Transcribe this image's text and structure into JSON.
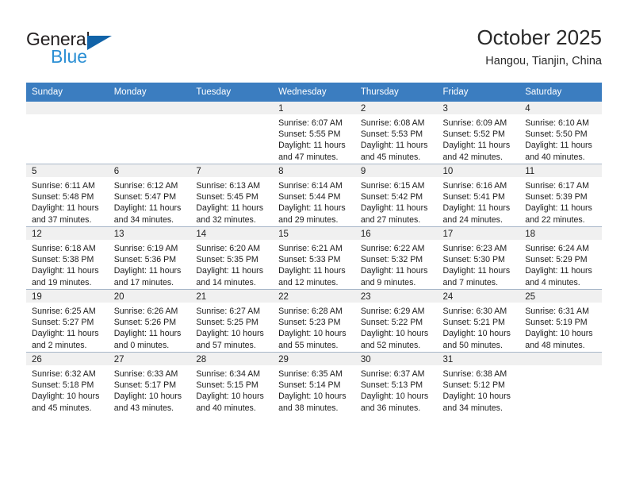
{
  "brand": {
    "name_dark": "General",
    "name_light": "Blue",
    "triangle_color": "#1163a8",
    "blue_color": "#2b8fd4"
  },
  "header": {
    "title": "October 2025",
    "subtitle": "Hangou, Tianjin, China"
  },
  "theme": {
    "header_row_bg": "#3b7dc0",
    "header_row_text": "#ffffff",
    "daynum_bg": "#f0f0f0",
    "grid_line": "#a9b8c9"
  },
  "weekdays": [
    "Sunday",
    "Monday",
    "Tuesday",
    "Wednesday",
    "Thursday",
    "Friday",
    "Saturday"
  ],
  "calendar": {
    "month": "October",
    "year": "2025",
    "location": "Hangou, Tianjin, China",
    "weeks": [
      [
        {
          "blank": true
        },
        {
          "blank": true
        },
        {
          "blank": true
        },
        {
          "day": "1",
          "sunrise": "Sunrise: 6:07 AM",
          "sunset": "Sunset: 5:55 PM",
          "daylight_1": "Daylight: 11 hours",
          "daylight_2": "and 47 minutes."
        },
        {
          "day": "2",
          "sunrise": "Sunrise: 6:08 AM",
          "sunset": "Sunset: 5:53 PM",
          "daylight_1": "Daylight: 11 hours",
          "daylight_2": "and 45 minutes."
        },
        {
          "day": "3",
          "sunrise": "Sunrise: 6:09 AM",
          "sunset": "Sunset: 5:52 PM",
          "daylight_1": "Daylight: 11 hours",
          "daylight_2": "and 42 minutes."
        },
        {
          "day": "4",
          "sunrise": "Sunrise: 6:10 AM",
          "sunset": "Sunset: 5:50 PM",
          "daylight_1": "Daylight: 11 hours",
          "daylight_2": "and 40 minutes."
        }
      ],
      [
        {
          "day": "5",
          "sunrise": "Sunrise: 6:11 AM",
          "sunset": "Sunset: 5:48 PM",
          "daylight_1": "Daylight: 11 hours",
          "daylight_2": "and 37 minutes."
        },
        {
          "day": "6",
          "sunrise": "Sunrise: 6:12 AM",
          "sunset": "Sunset: 5:47 PM",
          "daylight_1": "Daylight: 11 hours",
          "daylight_2": "and 34 minutes."
        },
        {
          "day": "7",
          "sunrise": "Sunrise: 6:13 AM",
          "sunset": "Sunset: 5:45 PM",
          "daylight_1": "Daylight: 11 hours",
          "daylight_2": "and 32 minutes."
        },
        {
          "day": "8",
          "sunrise": "Sunrise: 6:14 AM",
          "sunset": "Sunset: 5:44 PM",
          "daylight_1": "Daylight: 11 hours",
          "daylight_2": "and 29 minutes."
        },
        {
          "day": "9",
          "sunrise": "Sunrise: 6:15 AM",
          "sunset": "Sunset: 5:42 PM",
          "daylight_1": "Daylight: 11 hours",
          "daylight_2": "and 27 minutes."
        },
        {
          "day": "10",
          "sunrise": "Sunrise: 6:16 AM",
          "sunset": "Sunset: 5:41 PM",
          "daylight_1": "Daylight: 11 hours",
          "daylight_2": "and 24 minutes."
        },
        {
          "day": "11",
          "sunrise": "Sunrise: 6:17 AM",
          "sunset": "Sunset: 5:39 PM",
          "daylight_1": "Daylight: 11 hours",
          "daylight_2": "and 22 minutes."
        }
      ],
      [
        {
          "day": "12",
          "sunrise": "Sunrise: 6:18 AM",
          "sunset": "Sunset: 5:38 PM",
          "daylight_1": "Daylight: 11 hours",
          "daylight_2": "and 19 minutes."
        },
        {
          "day": "13",
          "sunrise": "Sunrise: 6:19 AM",
          "sunset": "Sunset: 5:36 PM",
          "daylight_1": "Daylight: 11 hours",
          "daylight_2": "and 17 minutes."
        },
        {
          "day": "14",
          "sunrise": "Sunrise: 6:20 AM",
          "sunset": "Sunset: 5:35 PM",
          "daylight_1": "Daylight: 11 hours",
          "daylight_2": "and 14 minutes."
        },
        {
          "day": "15",
          "sunrise": "Sunrise: 6:21 AM",
          "sunset": "Sunset: 5:33 PM",
          "daylight_1": "Daylight: 11 hours",
          "daylight_2": "and 12 minutes."
        },
        {
          "day": "16",
          "sunrise": "Sunrise: 6:22 AM",
          "sunset": "Sunset: 5:32 PM",
          "daylight_1": "Daylight: 11 hours",
          "daylight_2": "and 9 minutes."
        },
        {
          "day": "17",
          "sunrise": "Sunrise: 6:23 AM",
          "sunset": "Sunset: 5:30 PM",
          "daylight_1": "Daylight: 11 hours",
          "daylight_2": "and 7 minutes."
        },
        {
          "day": "18",
          "sunrise": "Sunrise: 6:24 AM",
          "sunset": "Sunset: 5:29 PM",
          "daylight_1": "Daylight: 11 hours",
          "daylight_2": "and 4 minutes."
        }
      ],
      [
        {
          "day": "19",
          "sunrise": "Sunrise: 6:25 AM",
          "sunset": "Sunset: 5:27 PM",
          "daylight_1": "Daylight: 11 hours",
          "daylight_2": "and 2 minutes."
        },
        {
          "day": "20",
          "sunrise": "Sunrise: 6:26 AM",
          "sunset": "Sunset: 5:26 PM",
          "daylight_1": "Daylight: 11 hours",
          "daylight_2": "and 0 minutes."
        },
        {
          "day": "21",
          "sunrise": "Sunrise: 6:27 AM",
          "sunset": "Sunset: 5:25 PM",
          "daylight_1": "Daylight: 10 hours",
          "daylight_2": "and 57 minutes."
        },
        {
          "day": "22",
          "sunrise": "Sunrise: 6:28 AM",
          "sunset": "Sunset: 5:23 PM",
          "daylight_1": "Daylight: 10 hours",
          "daylight_2": "and 55 minutes."
        },
        {
          "day": "23",
          "sunrise": "Sunrise: 6:29 AM",
          "sunset": "Sunset: 5:22 PM",
          "daylight_1": "Daylight: 10 hours",
          "daylight_2": "and 52 minutes."
        },
        {
          "day": "24",
          "sunrise": "Sunrise: 6:30 AM",
          "sunset": "Sunset: 5:21 PM",
          "daylight_1": "Daylight: 10 hours",
          "daylight_2": "and 50 minutes."
        },
        {
          "day": "25",
          "sunrise": "Sunrise: 6:31 AM",
          "sunset": "Sunset: 5:19 PM",
          "daylight_1": "Daylight: 10 hours",
          "daylight_2": "and 48 minutes."
        }
      ],
      [
        {
          "day": "26",
          "sunrise": "Sunrise: 6:32 AM",
          "sunset": "Sunset: 5:18 PM",
          "daylight_1": "Daylight: 10 hours",
          "daylight_2": "and 45 minutes."
        },
        {
          "day": "27",
          "sunrise": "Sunrise: 6:33 AM",
          "sunset": "Sunset: 5:17 PM",
          "daylight_1": "Daylight: 10 hours",
          "daylight_2": "and 43 minutes."
        },
        {
          "day": "28",
          "sunrise": "Sunrise: 6:34 AM",
          "sunset": "Sunset: 5:15 PM",
          "daylight_1": "Daylight: 10 hours",
          "daylight_2": "and 40 minutes."
        },
        {
          "day": "29",
          "sunrise": "Sunrise: 6:35 AM",
          "sunset": "Sunset: 5:14 PM",
          "daylight_1": "Daylight: 10 hours",
          "daylight_2": "and 38 minutes."
        },
        {
          "day": "30",
          "sunrise": "Sunrise: 6:37 AM",
          "sunset": "Sunset: 5:13 PM",
          "daylight_1": "Daylight: 10 hours",
          "daylight_2": "and 36 minutes."
        },
        {
          "day": "31",
          "sunrise": "Sunrise: 6:38 AM",
          "sunset": "Sunset: 5:12 PM",
          "daylight_1": "Daylight: 10 hours",
          "daylight_2": "and 34 minutes."
        },
        {
          "blank": true
        }
      ]
    ]
  }
}
